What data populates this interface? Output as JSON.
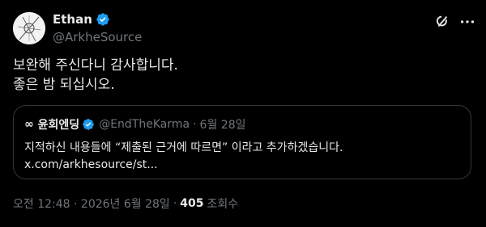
{
  "author": {
    "display_name": "Ethan",
    "handle": "@ArkheSource"
  },
  "tweet": {
    "text": "보완해 주신다니 감사합니다.\n좋은 밤 되십시오."
  },
  "quoted": {
    "emoji": "∞",
    "display_name": "윤회엔딩",
    "handle": "@EndTheKarma",
    "separator": "·",
    "date": "6월 28일",
    "text": "지적하신 내용들에 “제출된 근거에 따르면” 이라고 추가하겠습니다.\nx.com/arkhesource/st..."
  },
  "meta": {
    "time_date": "오전 12:48 · 2026년 6월 28일",
    "separator": "·",
    "views_count": "405",
    "views_label": "조회수"
  },
  "icons": {
    "verified": "verified-badge-icon",
    "grok": "grok-icon",
    "more": "more-options-icon"
  },
  "colors": {
    "background": "#000000",
    "text": "#e7e9ea",
    "secondary_text": "#71767b",
    "verified_blue": "#1d9bf0",
    "border": "#333639"
  }
}
